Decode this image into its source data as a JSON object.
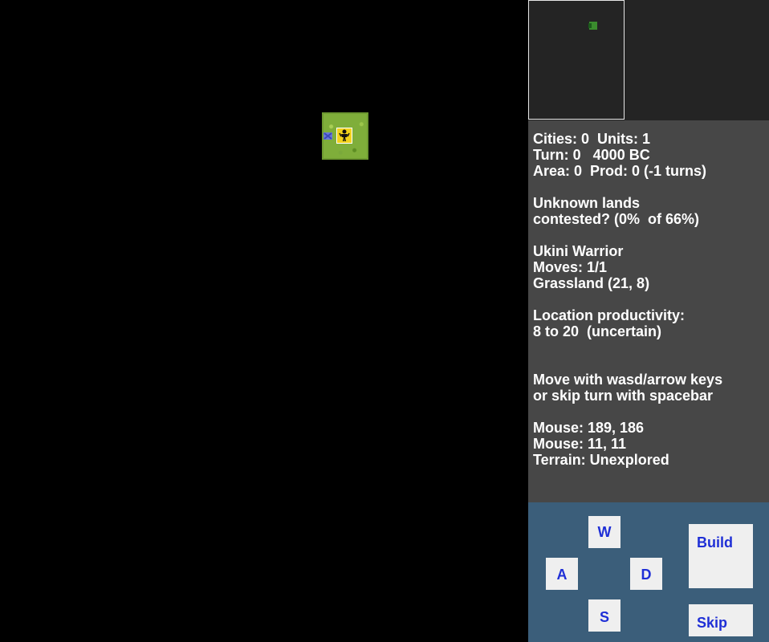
{
  "map": {
    "terrain_tile": "grassland",
    "unit_icon": "warrior-icon",
    "flag_icon": "flag-icon",
    "unit_badge_color": "#f2d21b"
  },
  "colors": {
    "map_background": "#000000",
    "minimap_background": "#242424",
    "info_background": "#474747",
    "controls_background": "#3b5e7a",
    "button_text": "#1f2fd6",
    "grass": "#7fae3a"
  },
  "info": {
    "summary": [
      "Cities: 0  Units: 1",
      "Turn: 0   4000 BC",
      "Area: 0  Prod: 0 (-1 turns)"
    ],
    "territory": [
      "Unknown lands",
      "contested? (0%  of 66%)"
    ],
    "unit": [
      "Ukini Warrior",
      "Moves: 1/1",
      "Grassland (21, 8)"
    ],
    "productivity": [
      "Location productivity:",
      "8 to 20  (uncertain)"
    ],
    "help": [
      "Move with wasd/arrow keys",
      "or skip turn with spacebar"
    ],
    "mouse": [
      "Mouse: 189, 186",
      "Mouse: 11, 11",
      "Terrain: Unexplored"
    ]
  },
  "controls": {
    "up": "W",
    "left": "A",
    "right": "D",
    "down": "S",
    "build": "Build",
    "skip": "Skip"
  }
}
